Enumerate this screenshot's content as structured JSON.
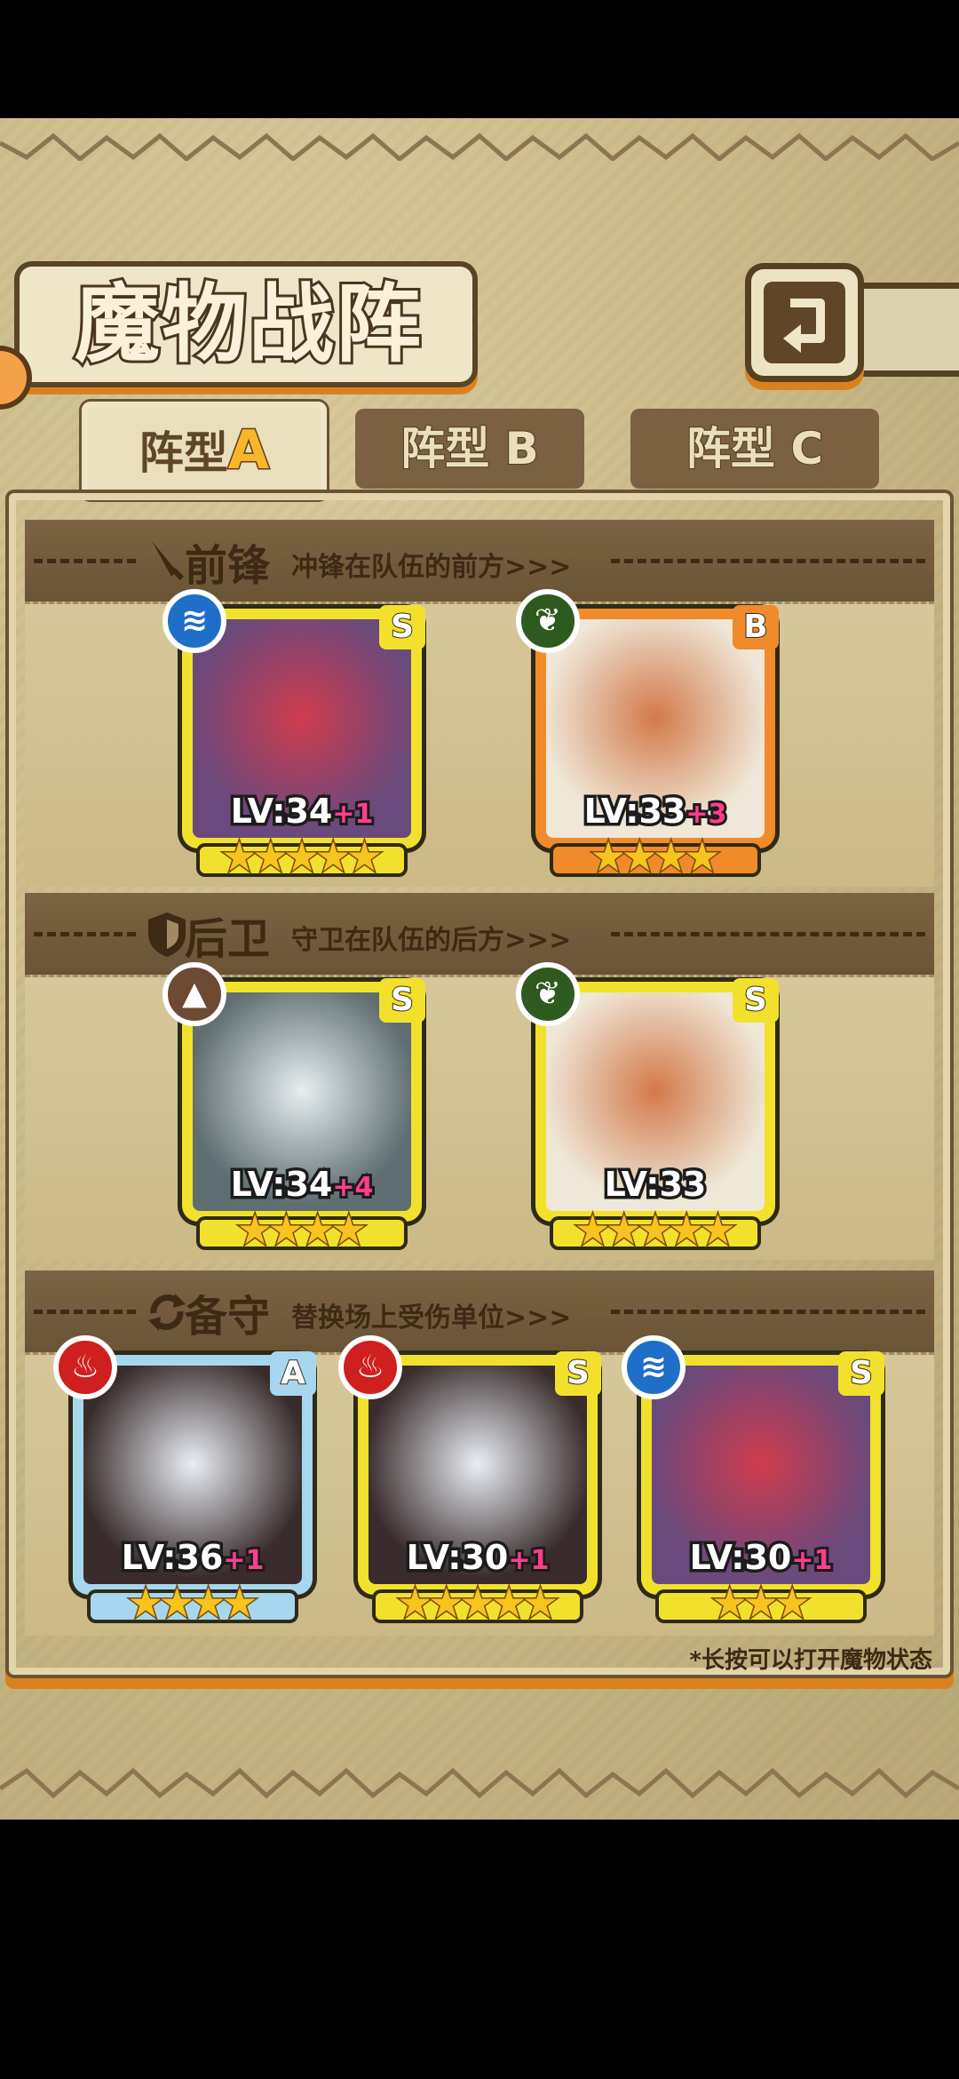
{
  "title": "魔物战阵",
  "tabs": [
    {
      "prefix": "阵型",
      "letter": "A",
      "active": true
    },
    {
      "prefix": "阵型",
      "letter": "B",
      "active": false
    },
    {
      "prefix": "阵型",
      "letter": "C",
      "active": false
    }
  ],
  "sections": {
    "front": {
      "name": "前锋",
      "desc": "冲锋在队伍的前方>>>",
      "icon": "sword-icon"
    },
    "rear": {
      "name": "后卫",
      "desc": "守卫在队伍的后方>>>",
      "icon": "shield-icon"
    },
    "reserve": {
      "name": "备守",
      "desc": "替换场上受伤单位>>>",
      "icon": "swap-icon"
    }
  },
  "cards": [
    {
      "section": "front",
      "element": "water",
      "rank": "S",
      "level": "LV:34",
      "bonus": "+1",
      "stars": 5
    },
    {
      "section": "front",
      "element": "nature",
      "rank": "B",
      "level": "LV:33",
      "bonus": "+3",
      "stars": 4
    },
    {
      "section": "rear",
      "element": "earth",
      "rank": "S",
      "level": "LV:34",
      "bonus": "+4",
      "stars": 4
    },
    {
      "section": "rear",
      "element": "nature",
      "rank": "S",
      "level": "LV:33",
      "bonus": "",
      "stars": 5
    },
    {
      "section": "reserve",
      "element": "fire",
      "rank": "A",
      "level": "LV:36",
      "bonus": "+1",
      "stars": 4
    },
    {
      "section": "reserve",
      "element": "fire",
      "rank": "S",
      "level": "LV:30",
      "bonus": "+1",
      "stars": 5
    },
    {
      "section": "reserve",
      "element": "water",
      "rank": "S",
      "level": "LV:30",
      "bonus": "+1",
      "stars": 3
    }
  ],
  "hint": "*长按可以打开魔物状态",
  "colors": {
    "rank_s": "#f2e12c",
    "rank_b": "#f08a2a",
    "rank_a": "#a7d7ef",
    "bonus": "#ff3d8c"
  }
}
